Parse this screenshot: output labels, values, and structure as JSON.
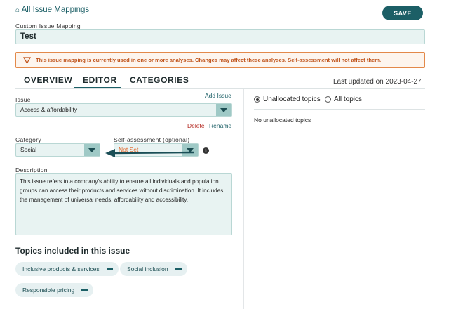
{
  "header": {
    "back_link": "All Issue Mappings",
    "save_label": "SAVE"
  },
  "mapping": {
    "label": "Custom Issue Mapping",
    "name": "Test"
  },
  "warning": {
    "text": "This issue mapping is currently used in one or more analyses. Changes may affect these analyses. Self-assessment will not affect them."
  },
  "tabs": [
    {
      "label": "OVERVIEW"
    },
    {
      "label": "EDITOR"
    },
    {
      "label": "CATEGORIES"
    }
  ],
  "last_updated": "Last updated on 2023-04-27",
  "issue": {
    "label": "Issue",
    "add_label": "Add Issue",
    "value": "Access & affordability",
    "delete_label": "Delete",
    "rename_label": "Rename"
  },
  "category": {
    "label": "Category",
    "value": "Social"
  },
  "self_assessment": {
    "label": "Self-assessment (optional)",
    "value": "Not Set"
  },
  "description": {
    "label": "Description",
    "text": "This issue refers to a company's ability to ensure all individuals and population groups can access their products and services without discrimination. It includes the management of universal needs, affordability and accessibility."
  },
  "topics": {
    "heading": "Topics included in this issue",
    "items": [
      {
        "label": "Inclusive products & services"
      },
      {
        "label": "Social inclusion"
      },
      {
        "label": "Responsible pricing"
      }
    ]
  },
  "right_panel": {
    "options": [
      {
        "label": "Unallocated topics",
        "checked": true
      },
      {
        "label": "All topics",
        "checked": false
      }
    ],
    "empty_text": "No unallocated topics"
  },
  "colors": {
    "accent": "#1c5f66",
    "warning_border": "#e3894a",
    "warning_bg": "#fdf5ee",
    "danger": "#b3261e",
    "not_set": "#e0662a"
  }
}
